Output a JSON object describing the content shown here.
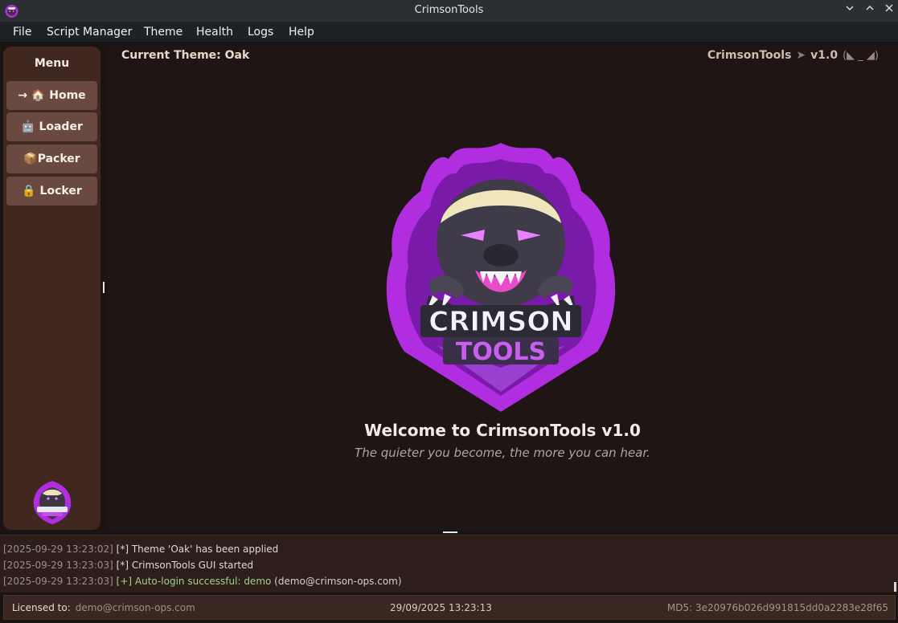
{
  "window": {
    "title": "CrimsonTools"
  },
  "menubar": {
    "items": [
      "File",
      "Script Manager",
      "Theme",
      "Health",
      "Logs",
      "Help"
    ]
  },
  "sidebar": {
    "title": "Menu",
    "items": [
      {
        "label": "→ 🏠 Home",
        "icon": "house-icon",
        "active": true
      },
      {
        "label": "🤖 Loader",
        "icon": "robot-icon",
        "active": false
      },
      {
        "label": "📦Packer",
        "icon": "package-icon",
        "active": false
      },
      {
        "label": "🔒 Locker",
        "icon": "lock-icon",
        "active": false
      }
    ]
  },
  "header": {
    "current_theme": "Current Theme: Oak",
    "brand": "CrimsonTools",
    "arrow": "➤",
    "version": "v1.0",
    "signal": "(◣ _ ◢)"
  },
  "welcome": {
    "heading": "Welcome to CrimsonTools v1.0",
    "tagline": "The quieter you become, the more you can hear."
  },
  "logo": {
    "line1": "CRIMSON",
    "line2": "TOOLS"
  },
  "log": {
    "entries": [
      {
        "timestamp": "[2025-09-29 13:23:02]",
        "tag": "[*]",
        "message": "Theme 'Oak' has been applied",
        "extra": ""
      },
      {
        "timestamp": "[2025-09-29 13:23:03]",
        "tag": "[*]",
        "message": "CrimsonTools GUI started",
        "extra": ""
      },
      {
        "timestamp": "[2025-09-29 13:23:03]",
        "tag": "[+]",
        "message": "Auto-login successful: demo",
        "extra": "(demo@crimson-ops.com)"
      }
    ]
  },
  "statusbar": {
    "licensed_label": "Licensed to:",
    "licensed_value": "demo@crimson-ops.com",
    "datetime": "29/09/2025 13:23:13",
    "md5": "MD5: 3e20976b026d991815dd0a2283e28f65"
  },
  "colors": {
    "accent_purple": "#b12de0",
    "sidebar_bg": "#40271f",
    "button_bg": "#6a4a40",
    "main_bg": "#1f1515",
    "success_text": "#9fd38a"
  }
}
